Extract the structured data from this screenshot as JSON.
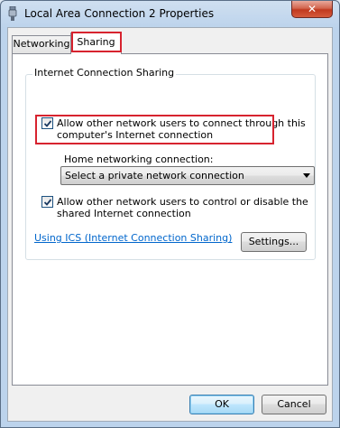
{
  "window": {
    "title": "Local Area Connection 2 Properties",
    "close_symbol": "✕"
  },
  "tabs": [
    {
      "label": "Networking",
      "selected": false
    },
    {
      "label": "Sharing",
      "selected": true
    }
  ],
  "sharing": {
    "group_label": "Internet Connection Sharing",
    "allow_connect": {
      "checked": true,
      "line1": "Allow other network users to connect through this",
      "line2": "computer's Internet connection"
    },
    "home_network_label": "Home networking connection:",
    "home_network_select": "Select a private network connection",
    "allow_control": {
      "checked": true,
      "line1": "Allow other network users to control or disable the",
      "line2": "shared Internet connection"
    },
    "ics_link": "Using ICS (Internet Connection Sharing)",
    "settings_button": "Settings..."
  },
  "footer": {
    "ok_label": "OK",
    "cancel_label": "Cancel"
  },
  "colors": {
    "highlight": "#d7232f",
    "link": "#0066cc"
  }
}
